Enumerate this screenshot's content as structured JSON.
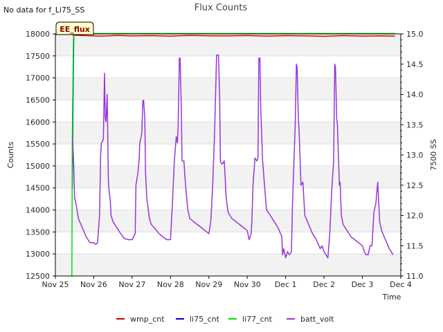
{
  "page": {
    "title": "Flux Counts",
    "no_data_note": "No data for f_Li75_SS",
    "badge": "EE_flux"
  },
  "colors": {
    "wmp_cnt": "#dd0000",
    "li75_cnt": "#0000cc",
    "li77_cnt": "#00dd00",
    "batt_volt": "#9933dd",
    "band": "#f2f2f2",
    "badge_bg": "#ffffcc"
  },
  "chart_data": {
    "type": "line",
    "title": "Flux Counts",
    "xlabel": "Time",
    "ylabel": "Counts",
    "y2label": "7500 SS",
    "xlim": [
      0,
      9
    ],
    "ylim": [
      12500,
      18000
    ],
    "y2lim": [
      11.0,
      15.0
    ],
    "x_tick_labels": [
      "Nov 25",
      "Nov 26",
      "Nov 27",
      "Nov 28",
      "Nov 29",
      "Nov 30",
      "Dec 1",
      "Dec 2",
      "Dec 3",
      "Dec 4"
    ],
    "y_ticks": [
      12500,
      13000,
      13500,
      14000,
      14500,
      15000,
      15500,
      16000,
      16500,
      17000,
      17500,
      18000
    ],
    "y2_ticks": [
      11.0,
      11.5,
      12.0,
      12.5,
      13.0,
      13.5,
      14.0,
      14.5,
      15.0
    ],
    "grid": true,
    "legend_position": "bottom",
    "series": [
      {
        "name": "wmp_cnt",
        "axis": "left",
        "x": [
          0.45,
          0.8,
          1.2,
          1.6,
          2.0,
          2.5,
          3.0,
          3.5,
          4.0,
          4.5,
          5.0,
          5.5,
          6.0,
          6.5,
          7.0,
          7.5,
          8.0,
          8.5,
          8.85
        ],
        "y": [
          17970,
          17960,
          17950,
          17965,
          17955,
          17960,
          17950,
          17965,
          17958,
          17955,
          17962,
          17950,
          17960,
          17955,
          17945,
          17960,
          17950,
          17955,
          17950
        ]
      },
      {
        "name": "li75_cnt",
        "axis": "left",
        "x": [
          0.44,
          0.46,
          0.48
        ],
        "y": [
          14500,
          16500,
          18000
        ]
      },
      {
        "name": "li77_cnt",
        "axis": "left",
        "x": [
          0.43,
          0.435,
          0.44,
          0.45,
          0.47,
          0.5,
          1.0,
          2.0,
          3.0,
          4.0,
          5.0,
          6.0,
          7.0,
          8.0,
          8.85
        ],
        "y": [
          12500,
          13800,
          15500,
          16500,
          17900,
          18010,
          18010,
          18010,
          18010,
          18010,
          18010,
          18010,
          18010,
          18010,
          18010
        ]
      },
      {
        "name": "batt_volt",
        "axis": "right",
        "x": [
          0.45,
          0.48,
          0.5,
          0.55,
          0.6,
          0.7,
          0.8,
          0.9,
          1.0,
          1.05,
          1.1,
          1.15,
          1.18,
          1.2,
          1.25,
          1.28,
          1.3,
          1.32,
          1.35,
          1.38,
          1.4,
          1.43,
          1.45,
          1.5,
          1.6,
          1.7,
          1.8,
          1.9,
          2.0,
          2.08,
          2.1,
          2.15,
          2.18,
          2.2,
          2.25,
          2.28,
          2.3,
          2.33,
          2.35,
          2.38,
          2.42,
          2.45,
          2.5,
          2.6,
          2.7,
          2.8,
          2.9,
          3.0,
          3.05,
          3.1,
          3.15,
          3.18,
          3.2,
          3.23,
          3.25,
          3.28,
          3.3,
          3.32,
          3.35,
          3.38,
          3.42,
          3.45,
          3.5,
          3.6,
          3.7,
          3.8,
          3.9,
          4.0,
          4.05,
          4.1,
          4.15,
          4.2,
          4.25,
          4.28,
          4.3,
          4.33,
          4.35,
          4.4,
          4.45,
          4.5,
          4.6,
          4.7,
          4.8,
          4.9,
          5.0,
          5.05,
          5.1,
          5.12,
          5.15,
          5.2,
          5.25,
          5.28,
          5.3,
          5.33,
          5.35,
          5.4,
          5.5,
          5.6,
          5.7,
          5.8,
          5.9,
          5.92,
          5.95,
          6.0,
          6.05,
          6.1,
          6.15,
          6.18,
          6.2,
          6.25,
          6.28,
          6.3,
          6.33,
          6.35,
          6.4,
          6.45,
          6.5,
          6.6,
          6.7,
          6.8,
          6.9,
          6.95,
          7.0,
          7.1,
          7.15,
          7.2,
          7.25,
          7.28,
          7.3,
          7.33,
          7.35,
          7.4,
          7.42,
          7.45,
          7.5,
          7.6,
          7.7,
          7.8,
          7.9,
          8.0,
          8.05,
          8.1,
          8.15,
          8.2,
          8.25,
          8.3,
          8.35,
          8.4,
          8.45,
          8.5,
          8.6,
          8.7,
          8.8
        ],
        "y": [
          13.25,
          12.8,
          12.3,
          12.15,
          11.95,
          11.8,
          11.65,
          11.55,
          11.55,
          11.52,
          11.55,
          12.0,
          13.0,
          13.2,
          13.25,
          14.35,
          13.6,
          13.55,
          14.0,
          12.6,
          12.4,
          12.25,
          12.0,
          11.9,
          11.8,
          11.7,
          11.62,
          11.6,
          11.6,
          11.7,
          12.5,
          12.7,
          12.9,
          13.2,
          13.35,
          13.9,
          13.9,
          13.6,
          12.7,
          12.3,
          12.1,
          11.95,
          11.85,
          11.78,
          11.7,
          11.65,
          11.6,
          11.6,
          12.2,
          12.9,
          13.3,
          13.2,
          13.5,
          14.6,
          14.6,
          13.8,
          12.9,
          12.9,
          12.9,
          12.6,
          12.3,
          12.1,
          11.95,
          11.9,
          11.85,
          11.8,
          11.75,
          11.7,
          11.9,
          12.5,
          13.4,
          14.65,
          14.65,
          14.0,
          12.9,
          12.85,
          12.85,
          12.9,
          12.3,
          12.05,
          11.95,
          11.9,
          11.85,
          11.8,
          11.75,
          11.6,
          11.7,
          11.9,
          12.5,
          12.95,
          12.9,
          12.95,
          14.6,
          14.6,
          13.8,
          12.9,
          12.1,
          12.0,
          11.9,
          11.8,
          11.65,
          11.35,
          11.45,
          11.3,
          11.4,
          11.35,
          11.4,
          12.2,
          12.6,
          13.5,
          14.5,
          14.45,
          13.6,
          13.4,
          12.5,
          12.55,
          12.0,
          11.85,
          11.7,
          11.6,
          11.45,
          11.5,
          11.4,
          11.3,
          11.7,
          12.4,
          12.9,
          14.5,
          14.45,
          13.6,
          13.5,
          12.5,
          12.55,
          12.0,
          11.85,
          11.75,
          11.65,
          11.6,
          11.55,
          11.5,
          11.4,
          11.35,
          11.35,
          11.5,
          11.5,
          12.05,
          12.2,
          12.55,
          11.9,
          11.75,
          11.6,
          11.45,
          11.35
        ]
      }
    ]
  }
}
